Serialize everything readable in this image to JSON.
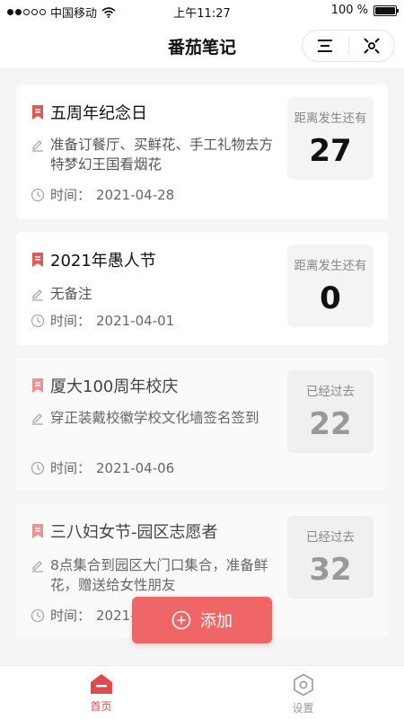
{
  "status_bar": {
    "carrier": "中国移动",
    "time": "上午11:27",
    "battery_percent": "100 %",
    "battery_level": 1.0
  },
  "nav": {
    "title": "番茄笔记",
    "menu_icon": "menu-icon",
    "close_icon": "capsule-close-icon"
  },
  "labels": {
    "time_prefix": "时间："
  },
  "events": [
    {
      "title": "五周年纪念日",
      "note": "准备订餐厅、买鲜花、手工礼物去方特梦幻王国看烟花",
      "date": "2021-04-28",
      "status_label": "距离发生还有",
      "days": "27",
      "past": false
    },
    {
      "title": "2021年愚人节",
      "note": "无备注",
      "date": "2021-04-01",
      "status_label": "距离发生还有",
      "days": "0",
      "past": false
    },
    {
      "title": "厦大100周年校庆",
      "note": "穿正装戴校徽学校文化墙签名签到",
      "date": "2021-04-06",
      "status_label": "已经过去",
      "days": "22",
      "past": true
    },
    {
      "title": "三八妇女节-园区志愿者",
      "note": "8点集合到园区大门口集合，准备鲜花，赠送给女性朋友",
      "date": "2021-",
      "status_label": "已经过去",
      "days": "32",
      "past": true
    }
  ],
  "add_button": {
    "label": "添加",
    "icon": "plus-circle-icon"
  },
  "tabs": [
    {
      "label": "首页",
      "icon": "home-icon",
      "active": true
    },
    {
      "label": "设置",
      "icon": "settings-hexagon-icon",
      "active": false
    }
  ],
  "colors": {
    "accent": "#f06666",
    "active_tab": "#e14a4a",
    "bookmark": "#e85555"
  }
}
